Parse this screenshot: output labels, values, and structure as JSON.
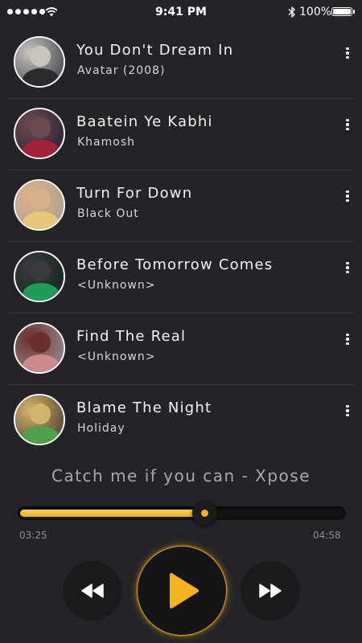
{
  "status_bar": {
    "time": "9:41 PM",
    "battery_text": "100%",
    "icons": [
      "signal-dots-icon",
      "wifi-icon",
      "bluetooth-icon",
      "battery-icon"
    ]
  },
  "songs": [
    {
      "title": "You Don't Dream In",
      "artist": "Avatar (2008)",
      "avatar_colors": [
        "#5c5f66",
        "#c9c4bd",
        "#2b2a2c"
      ]
    },
    {
      "title": "Baatein Ye Kabhi",
      "artist": "Khamosh",
      "avatar_colors": [
        "#3a2a3e",
        "#6b4a50",
        "#a5213a"
      ]
    },
    {
      "title": "Turn For Down",
      "artist": "Black Out",
      "avatar_colors": [
        "#b9a38d",
        "#d9b28b",
        "#e8c77a"
      ]
    },
    {
      "title": "Before Tomorrow Comes",
      "artist": "<Unknown>",
      "avatar_colors": [
        "#1c2b24",
        "#3a3a3e",
        "#1e9b57"
      ]
    },
    {
      "title": "Find The Real",
      "artist": "<Unknown>",
      "avatar_colors": [
        "#8e7a7e",
        "#6a2f2d",
        "#c98b8c"
      ]
    },
    {
      "title": "Blame The Night",
      "artist": "Holiday",
      "avatar_colors": [
        "#6a5a3c",
        "#d4b36a",
        "#4fa04a"
      ]
    }
  ],
  "player": {
    "now_playing": "Catch me if you can - Xpose",
    "elapsed": "03:25",
    "total": "04:58",
    "progress": 0.57,
    "accent_color": "#f5b31c",
    "controls": [
      "rewind-icon",
      "play-icon",
      "fast-forward-icon"
    ]
  }
}
